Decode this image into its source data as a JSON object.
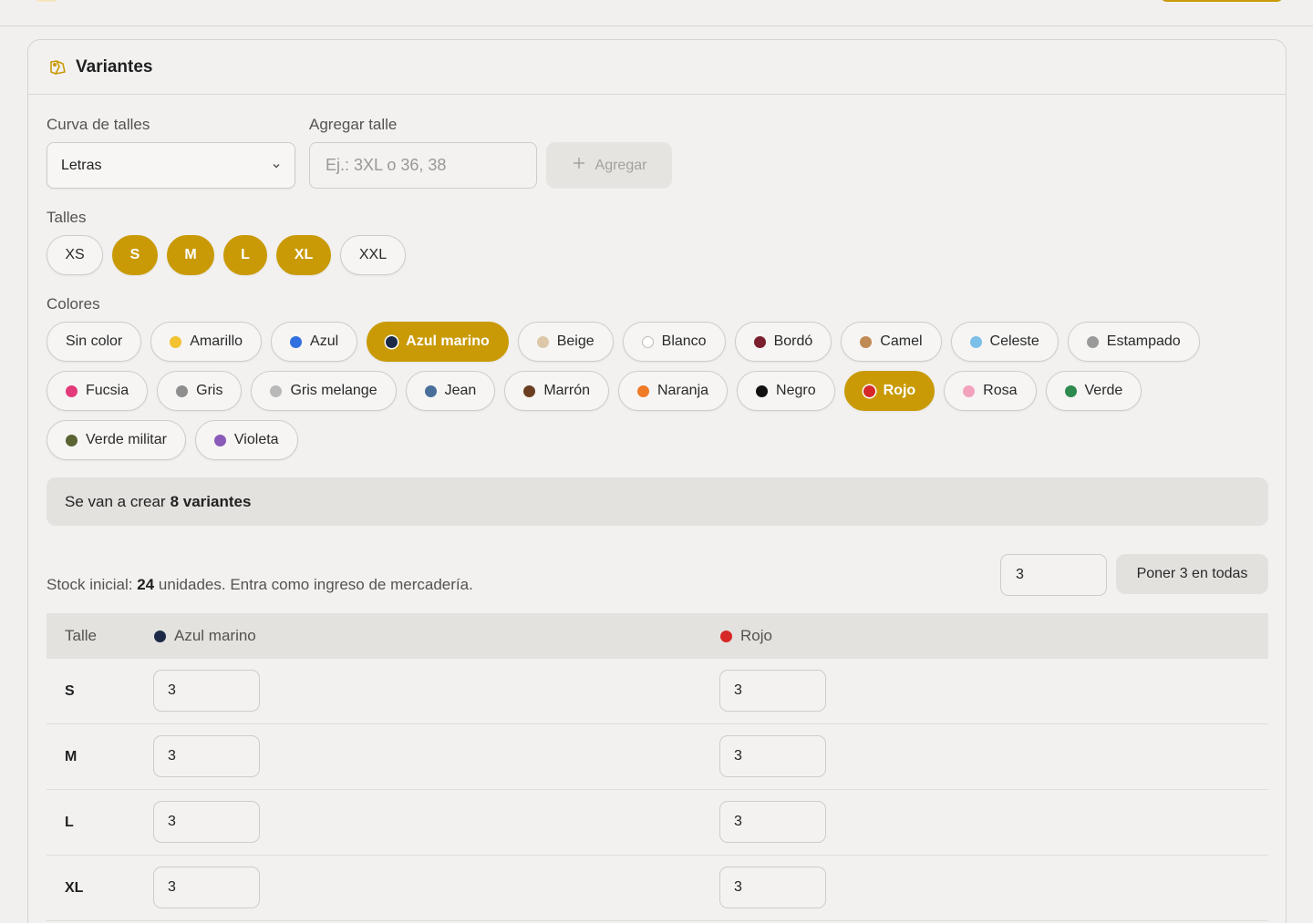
{
  "section": {
    "title": "Variantes",
    "icon": "tag-icon"
  },
  "size_curve": {
    "label": "Curva de talles",
    "selected": "Letras"
  },
  "add_size": {
    "label": "Agregar talle",
    "placeholder": "Ej.: 3XL o 36, 38",
    "button_label": "Agregar"
  },
  "sizes": {
    "label": "Talles",
    "items": [
      {
        "label": "XS",
        "selected": false
      },
      {
        "label": "S",
        "selected": true
      },
      {
        "label": "M",
        "selected": true
      },
      {
        "label": "L",
        "selected": true
      },
      {
        "label": "XL",
        "selected": true
      },
      {
        "label": "XXL",
        "selected": false
      }
    ]
  },
  "colors": {
    "label": "Colores",
    "accent": "#c99a06",
    "items": [
      {
        "label": "Sin color",
        "swatch": null,
        "selected": false
      },
      {
        "label": "Amarillo",
        "swatch": "#f2c230",
        "selected": false
      },
      {
        "label": "Azul",
        "swatch": "#2f6fe0",
        "selected": false
      },
      {
        "label": "Azul marino",
        "swatch": "#1c2a47",
        "selected": true
      },
      {
        "label": "Beige",
        "swatch": "#dcc8a8",
        "selected": false
      },
      {
        "label": "Blanco",
        "swatch": "#ffffff",
        "selected": false
      },
      {
        "label": "Bordó",
        "swatch": "#7a1f2e",
        "selected": false
      },
      {
        "label": "Camel",
        "swatch": "#c08a55",
        "selected": false
      },
      {
        "label": "Celeste",
        "swatch": "#7cbfe8",
        "selected": false
      },
      {
        "label": "Estampado",
        "swatch": "#9a9a9a",
        "selected": false
      },
      {
        "label": "Fucsia",
        "swatch": "#e23a7a",
        "selected": false
      },
      {
        "label": "Gris",
        "swatch": "#8e8e8e",
        "selected": false
      },
      {
        "label": "Gris melange",
        "swatch": "#b8b8b8",
        "selected": false
      },
      {
        "label": "Jean",
        "swatch": "#4a6e9a",
        "selected": false
      },
      {
        "label": "Marrón",
        "swatch": "#6b3e22",
        "selected": false
      },
      {
        "label": "Naranja",
        "swatch": "#f07a25",
        "selected": false
      },
      {
        "label": "Negro",
        "swatch": "#111111",
        "selected": false
      },
      {
        "label": "Rojo",
        "swatch": "#d62828",
        "selected": true
      },
      {
        "label": "Rosa",
        "swatch": "#f2a2bd",
        "selected": false
      },
      {
        "label": "Verde",
        "swatch": "#2e8a4e",
        "selected": false
      },
      {
        "label": "Verde militar",
        "swatch": "#5a6332",
        "selected": false
      },
      {
        "label": "Violeta",
        "swatch": "#8a5ab8",
        "selected": false
      }
    ]
  },
  "summary": {
    "prefix": "Se van a crear",
    "highlight": "8 variantes"
  },
  "stock": {
    "prefix": "Stock inicial:",
    "total": "24",
    "suffix": "unidades. Entra como ingreso de mercadería.",
    "bulk_value": "3",
    "bulk_button": "Poner 3 en todas"
  },
  "table": {
    "size_header": "Talle",
    "columns": [
      {
        "label": "Azul marino",
        "swatch": "#1c2a47"
      },
      {
        "label": "Rojo",
        "swatch": "#d62828"
      }
    ],
    "rows": [
      {
        "size": "S",
        "values": [
          "3",
          "3"
        ]
      },
      {
        "size": "M",
        "values": [
          "3",
          "3"
        ]
      },
      {
        "size": "L",
        "values": [
          "3",
          "3"
        ]
      },
      {
        "size": "XL",
        "values": [
          "3",
          "3"
        ]
      }
    ]
  }
}
